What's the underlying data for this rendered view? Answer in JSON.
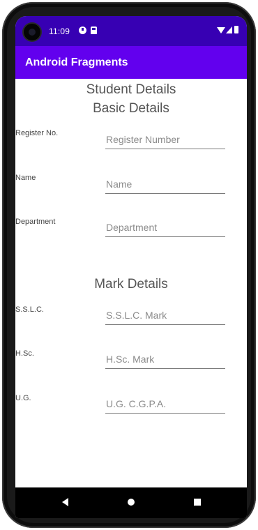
{
  "status_bar": {
    "time": "11:09",
    "icons": [
      "camera-icon",
      "notification-icon",
      "sim-card-icon",
      "wifi-icon",
      "signal-icon",
      "battery-icon"
    ]
  },
  "app_bar": {
    "title": "Android Fragments"
  },
  "colors": {
    "status_bar": "#3700b3",
    "app_bar": "#6200ee",
    "nav_bar": "#000000"
  },
  "basic": {
    "header": "Student Details",
    "subheader": "Basic Details",
    "fields": [
      {
        "label": "Register No.",
        "placeholder": "Register Number",
        "value": ""
      },
      {
        "label": "Name",
        "placeholder": "Name",
        "value": ""
      },
      {
        "label": "Department",
        "placeholder": "Department",
        "value": ""
      }
    ]
  },
  "marks": {
    "header": "Mark Details",
    "fields": [
      {
        "label": "S.S.L.C.",
        "placeholder": "S.S.L.C. Mark",
        "value": ""
      },
      {
        "label": "H.Sc.",
        "placeholder": "H.Sc. Mark",
        "value": ""
      },
      {
        "label": "U.G.",
        "placeholder": "U.G. C.G.P.A.",
        "value": ""
      }
    ]
  },
  "nav_bar": {
    "icons": [
      "back-icon",
      "home-icon",
      "recents-icon"
    ]
  }
}
